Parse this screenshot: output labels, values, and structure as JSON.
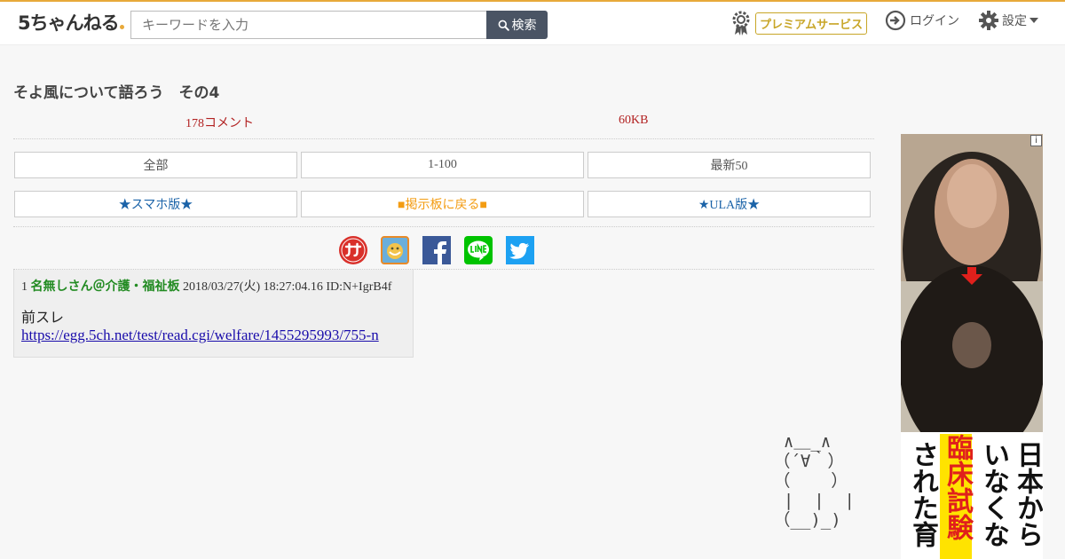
{
  "header": {
    "logo_text": "5ちゃんねる",
    "search_placeholder": "キーワードを入力",
    "search_button": "検索",
    "premium_label": "プレミアムサービス",
    "login_label": "ログイン",
    "settings_label": "設定"
  },
  "thread": {
    "title": "そよ風について語ろう　その4",
    "comment_count": "178コメント",
    "size": "60KB"
  },
  "nav_buttons": [
    "全部",
    "1-100",
    "最新50"
  ],
  "link_buttons": [
    "★スマホ版★",
    "■掲示板に戻る■",
    "★ULA版★"
  ],
  "share_icons": [
    "matome-icon",
    "bookmark-icon",
    "facebook-icon",
    "line-icon",
    "twitter-icon"
  ],
  "post": {
    "number": "1",
    "name": "名無しさん＠介護・福祉板",
    "date": "2018/03/27(火) 18:27:04.16",
    "id": "ID:N+IgrB4f",
    "body_text": "前スレ",
    "link": "https://egg.5ch.net/test/read.cgi/welfare/1455295993/755-n"
  },
  "ascii_art": "  ∧＿_∧\n （´∀｀）\n （    ）\n  |  |  |\n （__)_)",
  "ad": {
    "info_label": "i",
    "headline_col1": "日本から",
    "headline_col2": "いなくな",
    "headline_col3": "臨床試験",
    "headline_col4": "された育"
  },
  "colors": {
    "accent": "#e8a93a",
    "stat_red": "#b22222",
    "link_blue": "#1b63a8",
    "orange": "#f39c12",
    "name_green": "#228b22"
  }
}
